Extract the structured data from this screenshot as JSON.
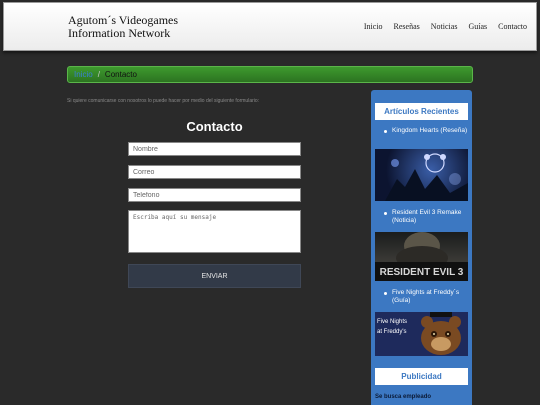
{
  "header": {
    "brand_line1": "Agutom´s Videogames",
    "brand_line2": "Information Network",
    "nav": [
      "Inicio",
      "Reseñas",
      "Noticias",
      "Guías",
      "Contacto"
    ]
  },
  "breadcrumb": {
    "home": "Inicio",
    "separator": "/",
    "current": "Contacto"
  },
  "intro": "Si quiere comunicarse con nosotros lo puede hacer por medio del siguiente formulario:",
  "form": {
    "title": "Contacto",
    "name_placeholder": "Nombre",
    "email_placeholder": "Correo",
    "phone_placeholder": "Telefono",
    "message_placeholder": "Escriba aquí su mensaje",
    "submit_label": "ENVIAR"
  },
  "sidebar": {
    "recent_title": "Artículos Recientes",
    "items": [
      {
        "label": "Kingdom Hearts (Reseña)"
      },
      {
        "label": "Resident Evil 3 Remake (Noticia)",
        "thumb_text": "RESIDENT EVIL 3"
      },
      {
        "label": "Five Nights at Freddy´s (Guía)",
        "thumb_text": "Five Nights at Freddy's"
      }
    ],
    "ad_title": "Publicidad",
    "ad_text": "Se busca empleado"
  },
  "colors": {
    "accent": "#3c78c2",
    "breadcrumb_green": "#2f7d24",
    "background": "#2a2a2a",
    "button": "#323a48"
  }
}
